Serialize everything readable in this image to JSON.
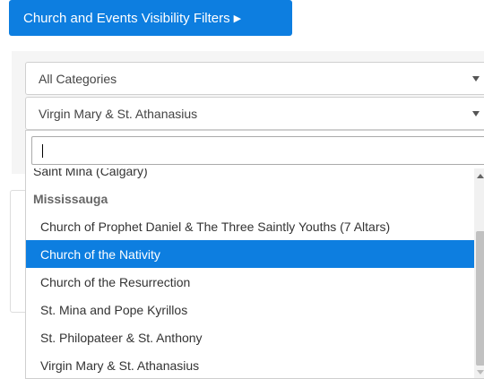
{
  "filter_button": {
    "label": "Church and Events Visibility Filters",
    "caret": "▶"
  },
  "category_select": {
    "value": "All Categories"
  },
  "church_select": {
    "value": "Virgin Mary & St. Athanasius"
  },
  "search": {
    "value": ""
  },
  "dropdown": {
    "partial_item": "Saint Mina (Calgary)",
    "group": "Mississauga",
    "items": [
      "Church of Prophet Daniel & The Three Saintly Youths (7 Altars)",
      "Church of the Nativity",
      "Church of the Resurrection",
      "St. Mina and Pope Kyrillos",
      "St. Philopateer & St. Anthony",
      "Virgin Mary & St. Athanasius"
    ],
    "highlighted": "Church of the Nativity"
  },
  "colors": {
    "accent": "#0d7ee0",
    "panel": "#f5f5f5"
  }
}
